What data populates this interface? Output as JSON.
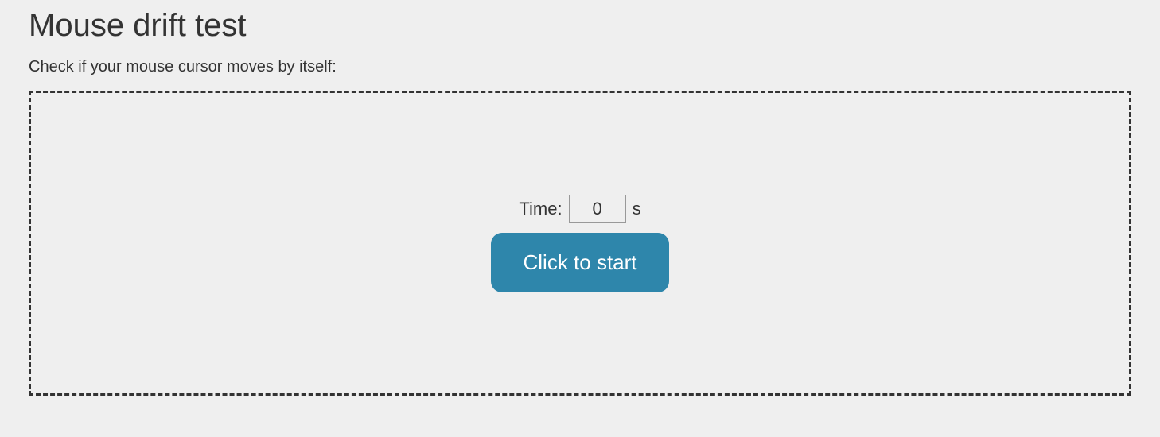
{
  "header": {
    "title": "Mouse drift test",
    "subtitle": "Check if your mouse cursor moves by itself:"
  },
  "test": {
    "time_label": "Time:",
    "time_value": "0",
    "time_unit": "s",
    "start_button": "Click to start"
  }
}
